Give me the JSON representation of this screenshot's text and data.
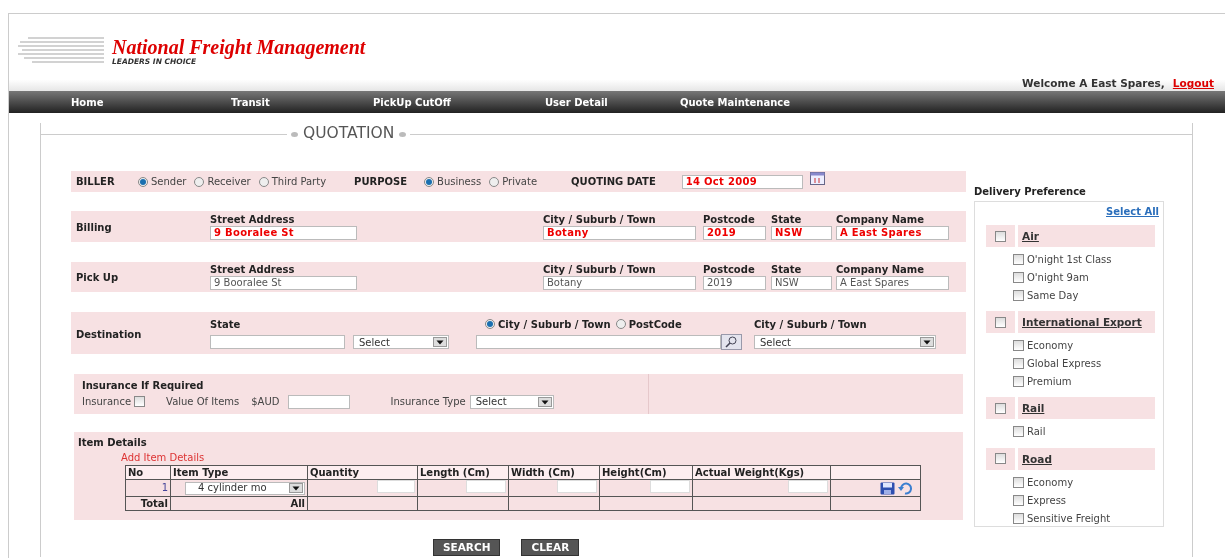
{
  "header": {
    "title": "National Freight Management",
    "tagline": "LEADERS IN CHOICE",
    "welcome": "Welcome A East Spares,",
    "logout": "Logout"
  },
  "nav": [
    {
      "label": "Home"
    },
    {
      "label": "Transit"
    },
    {
      "label": "PickUp CutOff"
    },
    {
      "label": "User Detail"
    },
    {
      "label": "Quote Maintenance"
    }
  ],
  "legend": "QUOTATION",
  "top_row": {
    "biller": {
      "label": "BILLER",
      "options": [
        {
          "label": "Sender",
          "selected": true
        },
        {
          "label": "Receiver",
          "selected": false
        },
        {
          "label": "Third Party",
          "selected": false
        }
      ]
    },
    "purpose": {
      "label": "PURPOSE",
      "options": [
        {
          "label": "Business",
          "selected": true
        },
        {
          "label": "Private",
          "selected": false
        }
      ]
    },
    "quoting_date": {
      "label": "QUOTING DATE",
      "value": "14 Oct 2009"
    }
  },
  "addresses": [
    {
      "label": "Billing",
      "disabled": false,
      "fields": [
        {
          "label": "Street Address",
          "value": "9 Booralee St"
        },
        {
          "label": "City / Suburb / Town",
          "value": "Botany"
        },
        {
          "label": "Postcode",
          "value": "2019"
        },
        {
          "label": "State",
          "value": "NSW"
        },
        {
          "label": "Company Name",
          "value": "A East Spares"
        }
      ]
    },
    {
      "label": "Pick Up",
      "disabled": true,
      "fields": [
        {
          "label": "Street Address",
          "value": "9 Booralee St"
        },
        {
          "label": "City / Suburb / Town",
          "value": "Botany"
        },
        {
          "label": "Postcode",
          "value": "2019"
        },
        {
          "label": "State",
          "value": "NSW"
        },
        {
          "label": "Company Name",
          "value": "A East Spares"
        }
      ]
    }
  ],
  "destination": {
    "label": "Destination",
    "state_label": "State",
    "state_select": "Select",
    "search_by": [
      {
        "label": "City / Suburb / Town",
        "selected": true
      },
      {
        "label": "PostCode",
        "selected": false
      }
    ],
    "city_label": "City / Suburb / Town",
    "city_select": "Select"
  },
  "insurance": {
    "title": "Insurance If Required",
    "checkbox_label": "Insurance",
    "checked": false,
    "value_label": "Value Of Items",
    "currency": "$AUD",
    "type_label": "Insurance Type",
    "type_select": "Select"
  },
  "items": {
    "title": "Item Details",
    "add_link": "Add Item Details",
    "columns": [
      "No",
      "Item Type",
      "Quantity",
      "Length (Cm)",
      "Width (Cm)",
      "Height(Cm)",
      "Actual Weight(Kgs)"
    ],
    "rows": [
      {
        "no": "1",
        "item_type": "4 cylinder mo"
      }
    ],
    "total": {
      "label": "Total",
      "item_type": "All"
    }
  },
  "delivery": {
    "title": "Delivery Preference",
    "select_all": "Select All",
    "groups": [
      {
        "name": "Air",
        "checked": false,
        "options": [
          {
            "label": "O'night 1st Class",
            "checked": false
          },
          {
            "label": "O'night 9am",
            "checked": false
          },
          {
            "label": "Same Day",
            "checked": false
          }
        ]
      },
      {
        "name": "International Export",
        "checked": false,
        "options": [
          {
            "label": "Economy",
            "checked": false
          },
          {
            "label": "Global Express",
            "checked": false
          },
          {
            "label": "Premium",
            "checked": false
          }
        ]
      },
      {
        "name": "Rail",
        "checked": false,
        "options": [
          {
            "label": "Rail",
            "checked": false
          }
        ]
      },
      {
        "name": "Road",
        "checked": false,
        "options": [
          {
            "label": "Economy",
            "checked": false
          },
          {
            "label": "Express",
            "checked": false
          },
          {
            "label": "Sensitive Freight",
            "checked": false
          }
        ]
      }
    ]
  },
  "buttons": [
    "SEARCH",
    "CLEAR"
  ]
}
